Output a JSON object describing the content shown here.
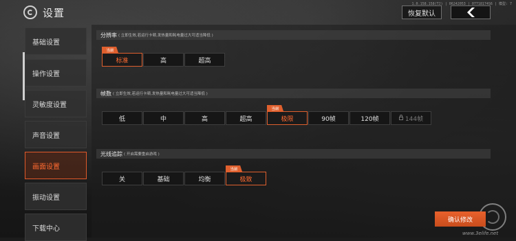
{
  "header": {
    "title": "设置",
    "version": "1.0.158.158(TJ) | 06242053 | 07718174S6 | 模型: 7",
    "reset_label": "恢复默认",
    "back_icon": "chevron-left-icon"
  },
  "sidebar": {
    "items": [
      {
        "label": "基础设置"
      },
      {
        "label": "操作设置"
      },
      {
        "label": "灵敏度设置"
      },
      {
        "label": "声音设置"
      },
      {
        "label": "画面设置",
        "active": true
      },
      {
        "label": "振动设置"
      },
      {
        "label": "下载中心"
      }
    ]
  },
  "sections": {
    "resolution": {
      "title": "分辨率",
      "hint": "( 立即生效,若运行卡顿,发热量和耗电量过大可适当降低 )",
      "badge": "当前",
      "options": [
        "标准",
        "高",
        "超高"
      ],
      "selected": "标准"
    },
    "framerate": {
      "title": "帧数",
      "hint": "( 立即生效,若运行卡顿,发热量和耗电量过大可适当降低 )",
      "badge": "当前",
      "options": [
        "低",
        "中",
        "高",
        "超高",
        "极限",
        "90帧",
        "120帧",
        "144帧"
      ],
      "selected": "极限",
      "locked": "144帧"
    },
    "raytracing": {
      "title": "光线追踪",
      "hint": "( 开启需要重启游戏 )",
      "badge": "当前",
      "options": [
        "关",
        "基础",
        "均衡",
        "极致"
      ],
      "selected": "极致"
    }
  },
  "footer": {
    "confirm_label": "确认修改",
    "watermark": "www.3elife.net"
  },
  "colors": {
    "accent": "#e0602e",
    "background": "#1c1c1c"
  }
}
